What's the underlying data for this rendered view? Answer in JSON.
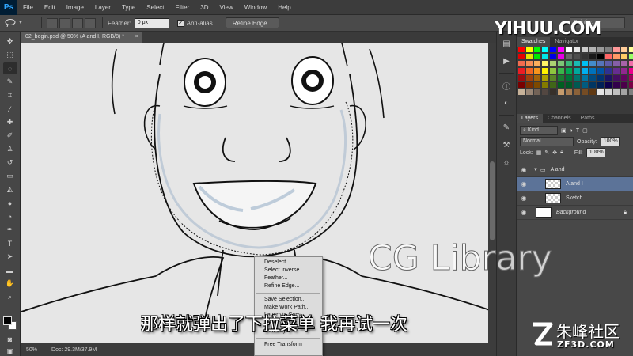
{
  "app": {
    "logo": "Ps"
  },
  "menubar": [
    "File",
    "Edit",
    "Image",
    "Layer",
    "Type",
    "Select",
    "Filter",
    "3D",
    "View",
    "Window",
    "Help"
  ],
  "options": {
    "feather_label": "Feather:",
    "feather_value": "0 px",
    "antialias_label": "Anti-alias",
    "antialias_checked": true,
    "refine_edge_button": "Refine Edge...",
    "workspace": "Painting"
  },
  "document": {
    "tab_title": "02_begin.psd @ 50% (A and I, RGB/8) *",
    "zoom": "50%",
    "doc_info": "Doc: 29.3M/37.9M"
  },
  "context_menu": {
    "group1": [
      "Deselect",
      "Select Inverse",
      "Feather...",
      "Refine Edge..."
    ],
    "group2": [
      "Save Selection...",
      "Make Work Path...",
      "Layer via Copy",
      "Layer via Cut",
      "New Layer..."
    ],
    "group3": [
      "Free Transform"
    ]
  },
  "panels": {
    "top_tabs": [
      "Swatches",
      "Navigator"
    ],
    "layer_tabs": [
      "Layers",
      "Channels",
      "Paths"
    ],
    "kind_label": "Kind",
    "blend_mode": "Normal",
    "opacity_label": "Opacity:",
    "opacity_value": "100%",
    "lock_label": "Lock:",
    "fill_label": "Fill:",
    "fill_value": "100%",
    "layers": [
      {
        "name": "A and I",
        "type": "group",
        "selected": false
      },
      {
        "name": "A and I",
        "type": "layer",
        "selected": true
      },
      {
        "name": "Sketch",
        "type": "layer",
        "selected": false
      },
      {
        "name": "Background",
        "type": "background",
        "selected": false
      }
    ]
  },
  "swatch_colors": [
    "#ff0000",
    "#ffff00",
    "#00ff00",
    "#00ffff",
    "#0000ff",
    "#ff00ff",
    "#ffffff",
    "#e6e6e6",
    "#cccccc",
    "#b3b3b3",
    "#999999",
    "#808080",
    "#ff9999",
    "#ffcc99",
    "#ffff99",
    "#e60000",
    "#e6e600",
    "#00e600",
    "#00e6e6",
    "#0000e6",
    "#e600e6",
    "#666666",
    "#4d4d4d",
    "#333333",
    "#1a1a1a",
    "#000000",
    "#ff6666",
    "#ff9966",
    "#ffcc66",
    "#99ff66",
    "#f26c4f",
    "#f68e55",
    "#fbaf5c",
    "#fff467",
    "#acd372",
    "#7cc576",
    "#3bb878",
    "#1abbb4",
    "#00bff3",
    "#438cca",
    "#5574b9",
    "#605ca8",
    "#855fa8",
    "#a763a8",
    "#f06ea9",
    "#ed1c24",
    "#f26522",
    "#f7941d",
    "#fff200",
    "#8dc63f",
    "#39b54a",
    "#00a651",
    "#00a99d",
    "#00aeef",
    "#0072bc",
    "#0054a6",
    "#2e3192",
    "#662d91",
    "#92278f",
    "#ec008c",
    "#9e0b0f",
    "#a0410d",
    "#a36209",
    "#aba000",
    "#598527",
    "#1a7b30",
    "#007236",
    "#00746b",
    "#0076a3",
    "#004b80",
    "#003471",
    "#1b1464",
    "#440e62",
    "#630460",
    "#9e005d",
    "#790000",
    "#7b2e00",
    "#7d4900",
    "#827b00",
    "#406618",
    "#005e20",
    "#005826",
    "#005952",
    "#005b7f",
    "#003663",
    "#002157",
    "#0d004c",
    "#32004b",
    "#4b0049",
    "#7b0046",
    "#c7b299",
    "#998675",
    "#736357",
    "#534741",
    "#37302a",
    "#c69c6d",
    "#a67c52",
    "#8c6239",
    "#754c24",
    "#603913",
    "#e5e5e5",
    "#d4d4d4",
    "#bfbfbf",
    "#a3a3a3",
    "#7f7f7f"
  ],
  "overlay": {
    "brand_top": "YIHUU.COM",
    "watermark": "CG Library",
    "subtitle": "那样就弹出了下拉菜单  我再试一次",
    "brand_cn": "朱峰社区",
    "brand_en": "ZF3D.COM"
  }
}
